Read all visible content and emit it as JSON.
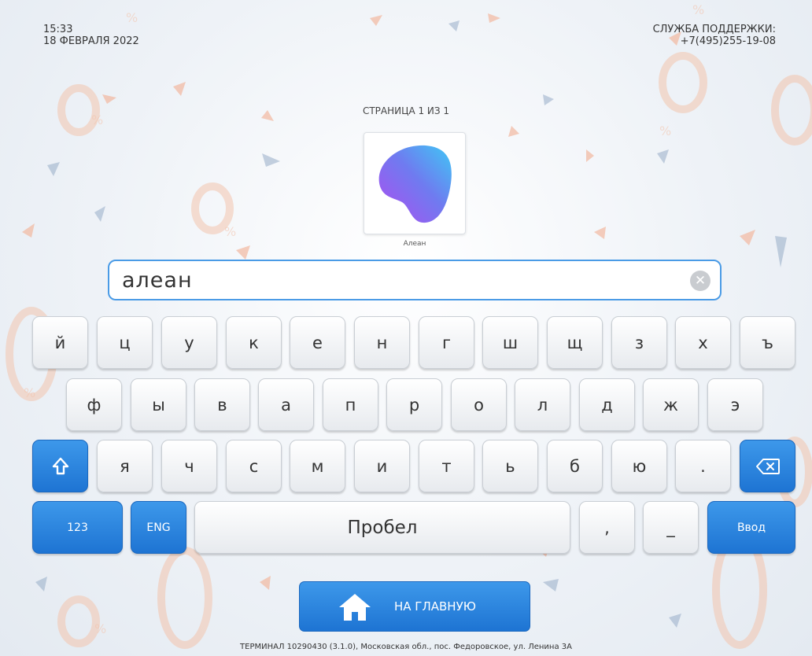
{
  "header": {
    "time": "15:33",
    "date": "18 ФЕВРАЛЯ 2022",
    "support_title": "СЛУЖБА ПОДДЕРЖКИ:",
    "support_phone": "+7(495)255-19-08"
  },
  "page_indicator": "СТРАНИЦА 1 ИЗ 1",
  "result": {
    "label": "Алеан"
  },
  "search": {
    "value": "алеан",
    "clear_icon": "close-icon"
  },
  "keyboard": {
    "row1": [
      "й",
      "ц",
      "у",
      "к",
      "е",
      "н",
      "г",
      "ш",
      "щ",
      "з",
      "х",
      "ъ"
    ],
    "row2": [
      "ф",
      "ы",
      "в",
      "а",
      "п",
      "р",
      "о",
      "л",
      "д",
      "ж",
      "э"
    ],
    "row3": [
      "я",
      "ч",
      "с",
      "м",
      "и",
      "т",
      "ь",
      "б",
      "ю",
      "."
    ],
    "shift_icon": "shift-arrow-icon",
    "backspace_icon": "backspace-icon",
    "numbers": "123",
    "lang": "ENG",
    "space": "Пробел",
    "comma": ",",
    "underscore": "_",
    "enter": "Ввод"
  },
  "home_button": {
    "label": "НА ГЛАВНУЮ",
    "icon": "home-icon"
  },
  "footer": "ТЕРМИНАЛ 10290430 (3.1.0), Московская обл., пос. Федоровское, ул. Ленина 3А",
  "colors": {
    "accent": "#2a86e0",
    "deco_orange": "#f0a27f",
    "deco_blue": "#8ea8c8"
  }
}
